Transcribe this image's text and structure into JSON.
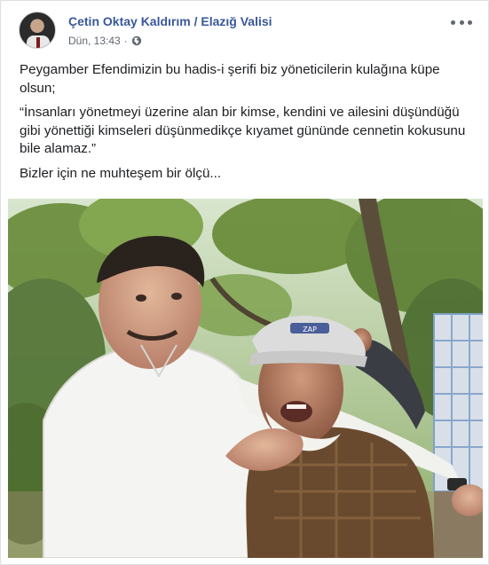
{
  "post": {
    "author": "Çetin Oktay Kaldırım / Elazığ Valisi",
    "timestamp": "Dün, 13:43",
    "separator": "·",
    "privacy_icon": "globe-icon",
    "menu_icon": "more-options-icon",
    "paragraphs": [
      "Peygamber Efendimizin bu hadis-i şerifi biz yöneticilerin kulağına küpe olsun;",
      "“İnsanları yönetmeyi üzerine alan bir kimse, kendini ve ailesini düşündüğü gibi yönettiği kimseleri düşünmedikçe kıyamet gününde cennetin kokusunu bile alamaz.”",
      "Bizler için ne muhteşem bir ölçü..."
    ],
    "photo_cap_text": "ZAP"
  },
  "colors": {
    "link": "#385898",
    "text": "#1c1e21",
    "meta": "#616770"
  }
}
